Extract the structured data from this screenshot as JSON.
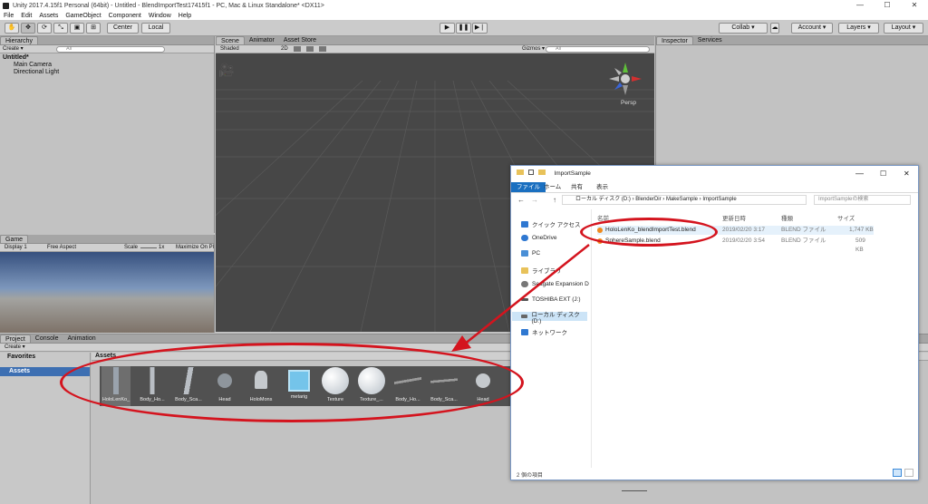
{
  "window": {
    "title": "Unity 2017.4.15f1 Personal (64bit) - Untitled - BlendImportTest17415f1 - PC, Mac & Linux Standalone* <DX11>",
    "minimize": "—",
    "maximize": "☐",
    "close": "✕"
  },
  "menu": [
    "File",
    "Edit",
    "Assets",
    "GameObject",
    "Component",
    "Window",
    "Help"
  ],
  "toolbar": {
    "tools": [
      "✋",
      "✥",
      "⟳",
      "⤡",
      "▣",
      "⊞"
    ],
    "pivot": "Center",
    "space": "Local",
    "play": "▶",
    "pause": "❚❚",
    "step": "▶❘",
    "collab": "Collab ▾",
    "account": "Account ▾",
    "layers": "Layers ▾",
    "layout": "Layout ▾"
  },
  "hierarchy": {
    "tab": "Hierarchy",
    "create": "Create ▾",
    "search_placeholder": "All",
    "scene": "Untitled*",
    "items": [
      "Main Camera",
      "Directional Light"
    ]
  },
  "scene_tabs": [
    "Scene",
    "Animator",
    "Asset Store"
  ],
  "scene_bar": {
    "shading": "Shaded",
    "mode2d": "2D",
    "gizmos": "Gizmos ▾",
    "search_placeholder": "All",
    "persp": "Persp"
  },
  "game": {
    "tab": "Game",
    "display": "Display 1",
    "aspect": "Free Aspect",
    "scale_label": "Scale",
    "scale_value": "1x",
    "maximize": "Maximize On Pl"
  },
  "inspector": {
    "tabs": [
      "Inspector",
      "Services"
    ]
  },
  "project": {
    "tabs": [
      "Project",
      "Console",
      "Animation"
    ],
    "create": "Create ▾",
    "favorites": "Favorites",
    "assets": "Assets",
    "breadcrumb": "Assets",
    "items": [
      {
        "label": "HoloLenKo_",
        "color": "#9aa3ad"
      },
      {
        "label": "Body_Ho...",
        "color": "#b9bec4"
      },
      {
        "label": "Body_Sca...",
        "color": "#b9bec4"
      },
      {
        "label": "Head",
        "color": "#c5c9cd"
      },
      {
        "label": "HoloMons",
        "color": "#c5c9cd"
      },
      {
        "label": "metarig",
        "color": "#74c4ea"
      },
      {
        "label": "Texture",
        "color": "#d8dde2"
      },
      {
        "label": "Texture_...",
        "color": "#d8dde2"
      },
      {
        "label": "Body_Ho...",
        "color": "#9a9a9a"
      },
      {
        "label": "Body_Sca...",
        "color": "#9a9a9a"
      },
      {
        "label": "Head",
        "color": "#c5c9cd"
      }
    ]
  },
  "explorer": {
    "title": "ImportSample",
    "ribbon": [
      "ファイル",
      "ホーム",
      "共有",
      "表示"
    ],
    "path": [
      "ローカル ディスク (D:)",
      "BlenderDir",
      "MakeSample",
      "ImportSample"
    ],
    "search_placeholder": "ImportSampleの検索",
    "columns": [
      "名前",
      "更新日時",
      "種類",
      "サイズ"
    ],
    "nav": [
      {
        "label": "クイック アクセス",
        "color": "#2f78d1"
      },
      {
        "label": "OneDrive",
        "color": "#2f78d1"
      },
      {
        "label": "PC",
        "color": "#4a8fd6"
      },
      {
        "label": "ライブラリ",
        "color": "#e8c25a"
      },
      {
        "label": "Seagate Expansion D",
        "color": "#777777"
      },
      {
        "label": "TOSHIBA EXT (J:)",
        "color": "#555555"
      },
      {
        "label": "ローカル ディスク (D:)",
        "color": "#666666"
      },
      {
        "label": "ネットワーク",
        "color": "#2f78d1"
      }
    ],
    "files": [
      {
        "name": "HoloLenKo_blendImportTest.blend",
        "date": "2019/02/20 3:17",
        "type": "BLEND ファイル",
        "size": "1,747 KB"
      },
      {
        "name": "SphereSample.blend",
        "date": "2019/02/20 3:54",
        "type": "BLEND ファイル",
        "size": "509 KB"
      }
    ],
    "status": "2 個の項目"
  }
}
